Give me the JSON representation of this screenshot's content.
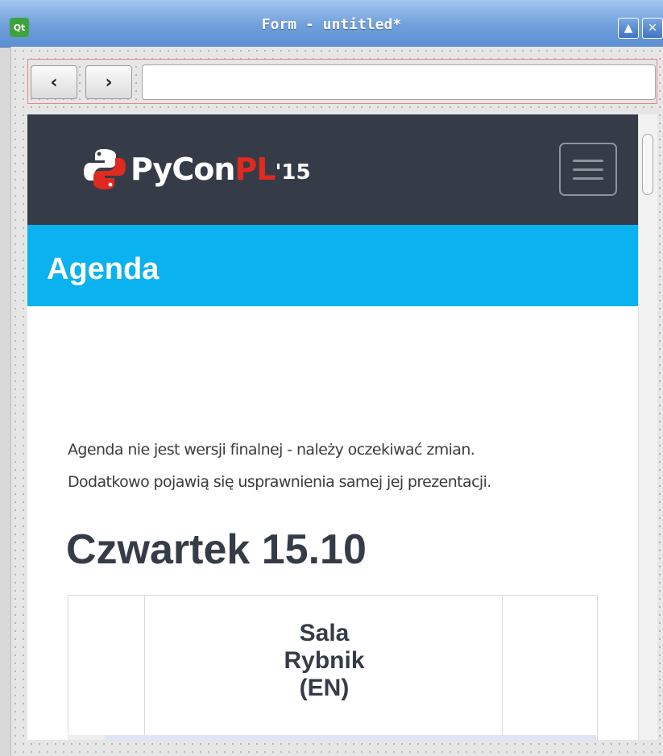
{
  "window": {
    "title": "Form - untitled*",
    "app_icon": "Qt",
    "maximize_symbol": "▲",
    "close_symbol": "✕"
  },
  "navbar": {
    "back_symbol": "‹",
    "forward_symbol": "›",
    "url_value": "",
    "url_placeholder": ""
  },
  "site": {
    "logo": {
      "py": "PyCon",
      "pl": "PL",
      "year": "'15"
    },
    "page_title": "Agenda",
    "notice_lines": [
      "Agenda nie jest wersji finalnej - należy oczekiwać zmian.",
      "Dodatkowo pojawią się usprawnienia samej jej prezentacji."
    ],
    "day_heading": "Czwartek 15.10",
    "room_header_lines": [
      "Sala",
      "Rybnik",
      "(EN)"
    ]
  },
  "colors": {
    "header_bg": "#353c48",
    "banner_bg": "#0ab2ef",
    "logo_red": "#e02a20"
  }
}
